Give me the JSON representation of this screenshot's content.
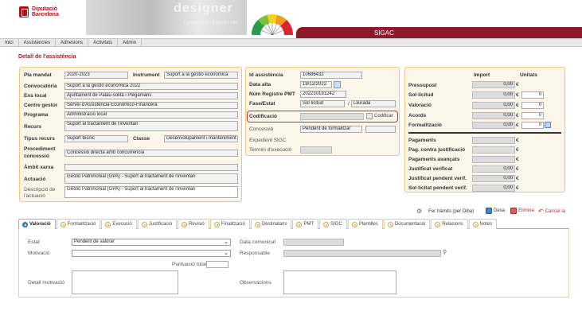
{
  "header": {
    "logo_line1": "Diputació",
    "logo_line2": "Barcelona",
    "banner_text1": "designer",
    "banner_text2": "Typography  •  Export  •  Hel",
    "app_title": "SIGAC"
  },
  "menu": [
    "Inici",
    "Assistències",
    "Adhesions",
    "Activitats",
    "Admin"
  ],
  "page_title": "Detall de l'assistència",
  "left": {
    "pla_mandat_label": "Pla mandat",
    "pla_mandat": "2020-2023",
    "instrument_label": "Instrument",
    "instrument": "Suport a la gestió econòmica",
    "convocatoria_label": "Convocatòria",
    "convocatoria": "Suport a la gestió econòmica 2022",
    "ens_local_label": "Ens local",
    "ens_local": "Ajuntament de Palau-solità i Plegamans",
    "centre_gestor_label": "Centre gestor",
    "centre_gestor": "Servei d'Assistència Econòmico-Financera",
    "programa_label": "Programa",
    "programa": "Administració local",
    "recurs_label": "Recurs",
    "recurs": "Suport al tractament de l'inventari",
    "tipus_recurs_label": "Tipus recurs",
    "tipus_recurs": "Suport tècnic",
    "classe_label": "Classe",
    "classe": "Desenvolupament i manteniment",
    "procediment_label1": "Procediment",
    "procediment_label2": "concessió",
    "procediment": "Concessió directa amb concurrència",
    "ambit_xarxa_label": "Àmbit xarxa",
    "ambit_xarxa": "",
    "actuacio_label": "Actuació",
    "actuacio": "Gestió Patrimonial (GPA) - Suport al tractament de l'inventari",
    "descripcio_label1": "Descripció de",
    "descripcio_label2": "l'actuació",
    "descripcio": "Gestió Patrimonial (GPA) - Suport al tractament de l'inventari"
  },
  "middle": {
    "id_label": "Id assistència",
    "id": "10686432",
    "data_alta_label": "Data alta",
    "data_alta": "19/12/2022",
    "registre_label": "Núm Registre PMT",
    "registre": "202210191242",
    "fase_label": "Fase/Estat",
    "fase": "Sol·licitud",
    "estat_sep": "/",
    "estat": "Lliurada",
    "codificacio_label": "Codificació",
    "codificacio": "",
    "codificar_button": "Codificar",
    "concessio_label": "Concessió",
    "concessio": "Pendent de formalitzar",
    "expedient_label": "Expedient SIGC",
    "termini_label": "Termini d'execució"
  },
  "right": {
    "import_header": "Import",
    "unitats_header": "Unitats",
    "rows": [
      {
        "label": "Pressupost",
        "import": "0,00",
        "cur": "€",
        "unitats": ""
      },
      {
        "label": "Sol·licitud",
        "import": "0,00",
        "cur": "€",
        "unitats": "0"
      },
      {
        "label": "Valoració",
        "import": "0,00",
        "cur": "€",
        "unitats": "0"
      },
      {
        "label": "Acords",
        "import": "0,00",
        "cur": "€",
        "unitats": "0"
      },
      {
        "label": "Formalització",
        "import": "0,00",
        "cur": "€",
        "unitats": "0"
      }
    ],
    "rows2": [
      {
        "label": "Pagaments",
        "import": "",
        "cur": "€"
      },
      {
        "label": "Pag. contra justificació",
        "import": "",
        "cur": "€"
      },
      {
        "label": "Pagaments avançats",
        "import": "",
        "cur": "€"
      },
      {
        "label": "Justificat verificat",
        "import": "0,00",
        "cur": "€"
      },
      {
        "label": "Justificat pendent verif.",
        "import": "0,00",
        "cur": "€"
      },
      {
        "label": "Sol·licitat pendent verif.",
        "import": "0,00",
        "cur": "€"
      }
    ]
  },
  "actions": {
    "tramits": "Fer tràmits (per Diba)",
    "desa": "Desa",
    "elimina": "Elimina",
    "cancella": "Cancel·la"
  },
  "tabs": [
    "Valoració",
    "Formalització",
    "Execució",
    "Justificació",
    "Revisió",
    "Finalització",
    "Destinataris",
    "PMT",
    "SIGC",
    "Plantilles",
    "Documentació",
    "Relacions",
    "Notes"
  ],
  "valoracio": {
    "estat_label": "Estat",
    "estat": "Pendent de valorar",
    "motivacio_label": "Motivació",
    "motivacio": "",
    "puntuacio_label": "Puntuació total:",
    "detall_label": "Detall motivació",
    "data_comunicat_label": "Data comunicat",
    "responsable_label": "Responsable",
    "observacions_label": "Observacions"
  },
  "colors": {
    "brand": "#b5121b",
    "sigac_bar": "#8c1a2b",
    "panel_border": "#f0c37f",
    "highlight": "#d9262d"
  }
}
